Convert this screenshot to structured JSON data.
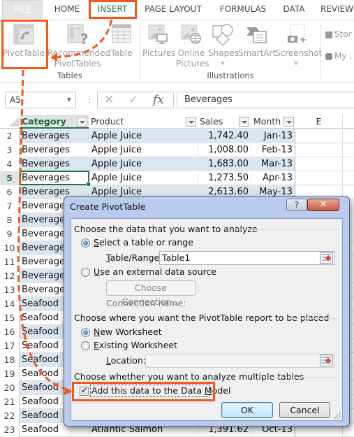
{
  "ribbon": {
    "tabs": [
      {
        "label": "FILE"
      },
      {
        "label": "HOME"
      },
      {
        "label": "INSERT",
        "active": true
      },
      {
        "label": "PAGE LAYOUT"
      },
      {
        "label": "FORMULAS"
      },
      {
        "label": "DATA"
      },
      {
        "label": "REVIEW"
      }
    ],
    "groups": {
      "tables": {
        "label": "Tables",
        "buttons": [
          {
            "label": "PivotTable",
            "icon": "pivottable-icon"
          },
          {
            "label": "Recommended",
            "label2": "PivotTables",
            "icon": "recommended-pivottables-icon"
          },
          {
            "label": "Table",
            "icon": "table-icon"
          }
        ]
      },
      "illustrations": {
        "label": "Illustrations",
        "buttons": [
          {
            "label": "Pictures",
            "icon": "pictures-icon"
          },
          {
            "label": "Online",
            "label2": "Pictures",
            "icon": "online-pictures-icon"
          },
          {
            "label": "Shapes",
            "icon": "shapes-icon",
            "dropdown": true
          },
          {
            "label": "SmartArt",
            "icon": "smartart-icon"
          },
          {
            "label": "Screenshot",
            "icon": "screenshot-icon",
            "dropdown": true
          }
        ]
      },
      "apps": {
        "buttons": [
          {
            "label": "Stor",
            "icon": "store-icon"
          },
          {
            "label": "My .",
            "icon": "my-apps-icon"
          }
        ]
      }
    }
  },
  "formula_bar": {
    "name_box": "A5",
    "cancel_glyph": "✕",
    "enter_glyph": "✓",
    "fx_label": "fx",
    "content": "Beverages"
  },
  "sheet": {
    "columns": [
      {
        "label": "Category",
        "filter": true
      },
      {
        "label": "Product",
        "filter": true
      },
      {
        "label": "Sales",
        "filter": true
      },
      {
        "label": "Month",
        "filter": true
      },
      {
        "label": "E",
        "filter": false
      }
    ],
    "active_cell": "A5",
    "rows": [
      {
        "num": "2",
        "category": "Beverages",
        "product": "Apple Juice",
        "sales": "1,742.40",
        "month": "Jan-13"
      },
      {
        "num": "3",
        "category": "Beverages",
        "product": "Apple Juice",
        "sales": "1,008.00",
        "month": "Feb-13"
      },
      {
        "num": "4",
        "category": "Beverages",
        "product": "Apple Juice",
        "sales": "1,683.00",
        "month": "Mar-13"
      },
      {
        "num": "5",
        "category": "Beverages",
        "product": "Apple Juice",
        "sales": "1,273.50",
        "month": "Apr-13"
      },
      {
        "num": "6",
        "category": "Beverages",
        "product": "Apple Juice",
        "sales": "2,613.60",
        "month": "May-13"
      },
      {
        "num": "7",
        "category": "Beverages",
        "product": "",
        "sales": "",
        "month": ""
      },
      {
        "num": "8",
        "category": "Beverages",
        "product": "",
        "sales": "",
        "month": ""
      },
      {
        "num": "9",
        "category": "Beverages",
        "product": "",
        "sales": "",
        "month": ""
      },
      {
        "num": "10",
        "category": "Beverages",
        "product": "",
        "sales": "",
        "month": ""
      },
      {
        "num": "11",
        "category": "Beverages",
        "product": "",
        "sales": "",
        "month": ""
      },
      {
        "num": "12",
        "category": "Beverages",
        "product": "",
        "sales": "",
        "month": ""
      },
      {
        "num": "13",
        "category": "Beverages",
        "product": "",
        "sales": "",
        "month": ""
      },
      {
        "num": "14",
        "category": "Seafood",
        "product": "",
        "sales": "",
        "month": ""
      },
      {
        "num": "15",
        "category": "Seafood",
        "product": "",
        "sales": "",
        "month": ""
      },
      {
        "num": "16",
        "category": "Seafood",
        "product": "",
        "sales": "",
        "month": ""
      },
      {
        "num": "17",
        "category": "Seafood",
        "product": "",
        "sales": "",
        "month": ""
      },
      {
        "num": "18",
        "category": "Seafood",
        "product": "",
        "sales": "",
        "month": ""
      },
      {
        "num": "19",
        "category": "Seafood",
        "product": "",
        "sales": "",
        "month": ""
      },
      {
        "num": "20",
        "category": "Seafood",
        "product": "",
        "sales": "",
        "month": ""
      },
      {
        "num": "21",
        "category": "Seafood",
        "product": "",
        "sales": "",
        "month": ""
      },
      {
        "num": "22",
        "category": "Seafood",
        "product": "",
        "sales": "",
        "month": ""
      },
      {
        "num": "23",
        "category": "Seafood",
        "product": "Atlantic Salmon",
        "sales": "1,391.62",
        "month": "Oct-13"
      }
    ]
  },
  "dialog": {
    "title": "Create PivotTable",
    "help_glyph": "?",
    "close_glyph": "✕",
    "section1": "Choose the data that you want to analyze",
    "opt_select_table": {
      "pre": "",
      "key": "S",
      "post": "elect a table or range",
      "selected": true
    },
    "table_range_label": {
      "key": "T",
      "post": "able/Range:"
    },
    "table_range_value": "Table1",
    "opt_external": {
      "key": "U",
      "post": "se an external data source",
      "selected": false
    },
    "choose_connection": "Choose Connection...",
    "connection_name_label": "Connection name:",
    "section2": "Choose where you want the PivotTable report to be placed",
    "opt_new_ws": {
      "key": "N",
      "post": "ew Worksheet",
      "selected": true
    },
    "opt_existing_ws": {
      "key": "E",
      "post": "xisting Worksheet",
      "selected": false
    },
    "location_label": {
      "key": "L",
      "post": "ocation:"
    },
    "location_value": "",
    "section3": "Choose whether you want to analyze multiple tables",
    "data_model": {
      "pre": "Add this data to the Data ",
      "key": "M",
      "post": "odel",
      "checked": true
    },
    "ok_label": "OK",
    "cancel_label": "Cancel"
  },
  "colors": {
    "accent_orange": "#f05a1a",
    "excel_green": "#217346",
    "table_band": "#dce6f1"
  }
}
